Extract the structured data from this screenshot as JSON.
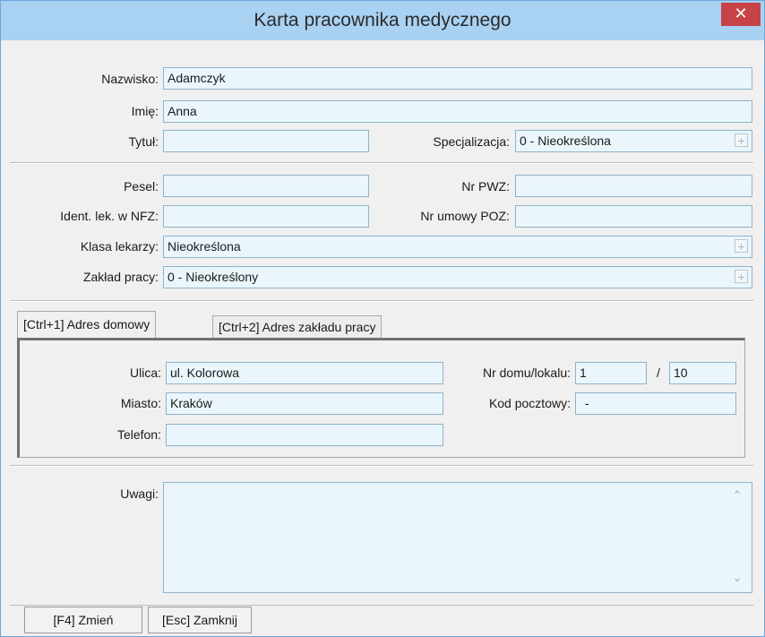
{
  "window": {
    "title": "Karta pracownika medycznego",
    "close_symbol": "✕"
  },
  "fields": {
    "nazwisko": {
      "label": "Nazwisko:",
      "value": "Adamczyk"
    },
    "imie": {
      "label": "Imię:",
      "value": "Anna"
    },
    "tytul": {
      "label": "Tytuł:",
      "value": ""
    },
    "specjalizacja": {
      "label": "Specjalizacja:",
      "value": "0 - Nieokreślona"
    },
    "pesel": {
      "label": "Pesel:",
      "value": ""
    },
    "nr_pwz": {
      "label": "Nr PWZ:",
      "value": ""
    },
    "ident_nfz": {
      "label": "Ident. lek. w NFZ:",
      "value": ""
    },
    "nr_umowy": {
      "label": "Nr umowy POZ:",
      "value": ""
    },
    "klasa": {
      "label": "Klasa lekarzy:",
      "value": "Nieokreślona"
    },
    "zaklad": {
      "label": "Zakład pracy:",
      "value": "0 - Nieokreślony"
    }
  },
  "tabs": [
    {
      "label": "[Ctrl+1] Adres domowy",
      "active": true
    },
    {
      "label": "[Ctrl+2] Adres zakładu pracy",
      "active": false
    }
  ],
  "address": {
    "ulica": {
      "label": "Ulica:",
      "value": "ul. Kolorowa"
    },
    "miasto": {
      "label": "Miasto:",
      "value": "Kraków"
    },
    "telefon": {
      "label": "Telefon:",
      "value": ""
    },
    "nr_domu": {
      "label": "Nr domu/lokalu:",
      "value": "1",
      "separator": "/",
      "lokal": "10"
    },
    "kod": {
      "label": "Kod pocztowy:",
      "value": "-"
    }
  },
  "uwagi": {
    "label": "Uwagi:",
    "value": ""
  },
  "buttons": {
    "change": "[F4] Zmień",
    "close": "[Esc] Zamknij"
  },
  "plus_symbol": "+",
  "scroll_up_symbol": "⌃",
  "scroll_down_symbol": "⌄"
}
